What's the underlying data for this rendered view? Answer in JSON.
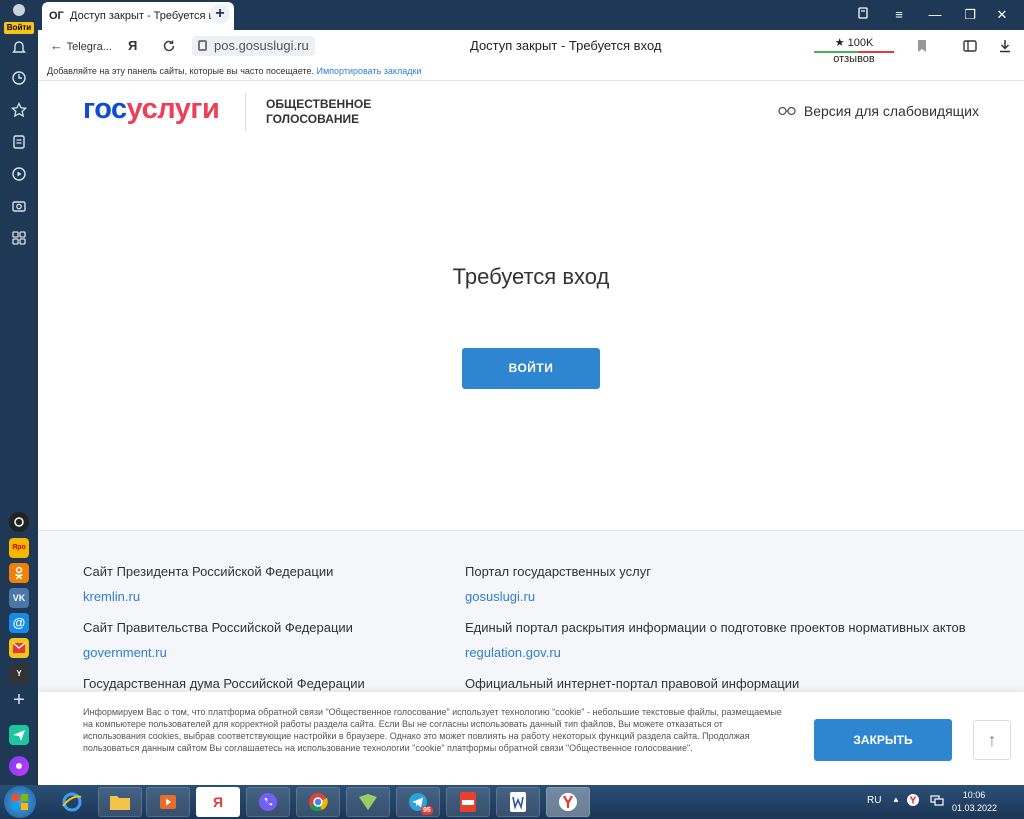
{
  "sidebar": {
    "login_label": "Войти",
    "yandex_tile": "Яро"
  },
  "tab": {
    "favicon_text": "ОГ",
    "title": "Доступ закрыт - Требуется вход",
    "close": "×",
    "new_tab": "+"
  },
  "window": {
    "minimize": "—",
    "restore": "❐",
    "close": "✕",
    "menu": "≡"
  },
  "addressbar": {
    "back_label": "Telegra...",
    "yandex_icon": "Я",
    "url": "pos.gosuslugi.ru",
    "page_title": "Доступ закрыт - Требуется вход",
    "reviews": "★ 100K отзывов"
  },
  "bookmarks": {
    "hint": "Добавляйте на эту панель сайты, которые вы часто посещаете.",
    "import_link": "Импортировать закладки"
  },
  "header": {
    "logo_part1": "гос",
    "logo_part2": "услуги",
    "subtitle": "Общественное голосование",
    "vision_link": "Версия для слабовидящих"
  },
  "main": {
    "title": "Требуется вход",
    "login_button": "Войти"
  },
  "footer": {
    "links": [
      {
        "label": "Сайт Президента Российской Федерации",
        "url": "kremlin.ru"
      },
      {
        "label": "Портал государственных услуг",
        "url": "gosuslugi.ru"
      },
      {
        "label": "Сайт Правительства Российской Федерации",
        "url": "government.ru"
      },
      {
        "label": "Единый портал раскрытия информации о подготовке проектов нормативных актов",
        "url": "regulation.gov.ru"
      },
      {
        "label": "Государственная дума Российской Федерации",
        "url": ""
      },
      {
        "label": "Официальный интернет-портал правовой информации",
        "url": ""
      }
    ]
  },
  "cookie": {
    "text": "Информируем Вас о том, что платформа обратной связи \"Общественное голосование\" использует технологию \"cookie\" - небольшие текстовые файлы, размещаемые на компьютере пользователей для корректной работы раздела сайта. Если Вы не согласны использовать данный тип файлов, Вы можете отказаться от использования cookies, выбрав соответствующие настройки в браузере. Однако это может повлиять на работу некоторых функций раздела сайта. Продолжая пользоваться данным сайтом Вы соглашаетесь на использование технологии \"cookie\" платформы обратной связи \"Общественное голосование\".",
    "close_button": "Закрыть",
    "up_arrow": "↑"
  },
  "taskbar": {
    "yandex_app": "Я",
    "lang": "RU",
    "time": "10:06",
    "date": "01.03.2022",
    "telegram_badge": "95"
  },
  "colors": {
    "accent": "#2f86d0",
    "gos_blue": "#0d4cd3",
    "uslugi_red": "#ee3f58",
    "sidebar_bg": "#1e3855"
  }
}
